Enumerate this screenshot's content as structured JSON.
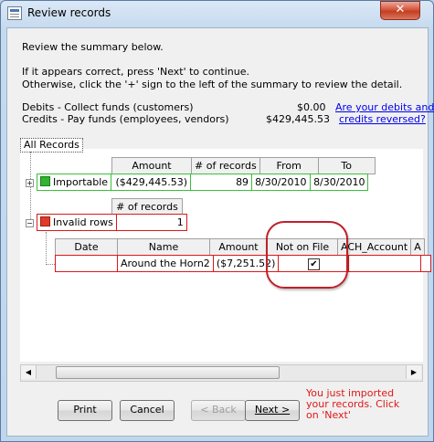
{
  "window": {
    "title": "Review records",
    "close": "✕"
  },
  "intro": {
    "line1": "Review the summary below.",
    "line2": "If it appears correct, press 'Next' to continue.",
    "line3": "Otherwise, click the '+' sign to the left of the summary to review the detail."
  },
  "summary": {
    "debits_label": "Debits  - Collect funds (customers)",
    "debits_value": "$0.00",
    "credits_label": "Credits - Pay funds (employees, vendors)",
    "credits_value": "$429,445.53",
    "reversed_link_1": "Are your debits and",
    "reversed_link_2": "credits reversed?"
  },
  "tree": {
    "root": "All Records",
    "importable": {
      "label": "Importable",
      "headers": [
        "Amount",
        "# of records",
        "From",
        "To"
      ],
      "values": [
        "($429,445.53)",
        "89",
        "8/30/2010",
        "8/30/2010"
      ]
    },
    "invalid": {
      "label": "Invalid rows",
      "header": "# of records",
      "value": "1",
      "detail_headers": [
        "Date",
        "Name",
        "Amount",
        "Not on File",
        "ACH_Account",
        "A"
      ],
      "detail_row": {
        "date": "",
        "name": "Around the Horn2",
        "amount": "($7,251.52)",
        "not_on_file": "✔",
        "ach_account": ""
      }
    }
  },
  "buttons": {
    "print": "Print",
    "cancel": "Cancel",
    "back": "< Back",
    "next": "Next >"
  },
  "hint": {
    "line1": "You just imported",
    "line2": "your records. Click",
    "line3": "on 'Next'"
  },
  "colors": {
    "hint": "#e01818",
    "green": "#39c039",
    "red": "#d9191b",
    "link": "#0000ee"
  }
}
